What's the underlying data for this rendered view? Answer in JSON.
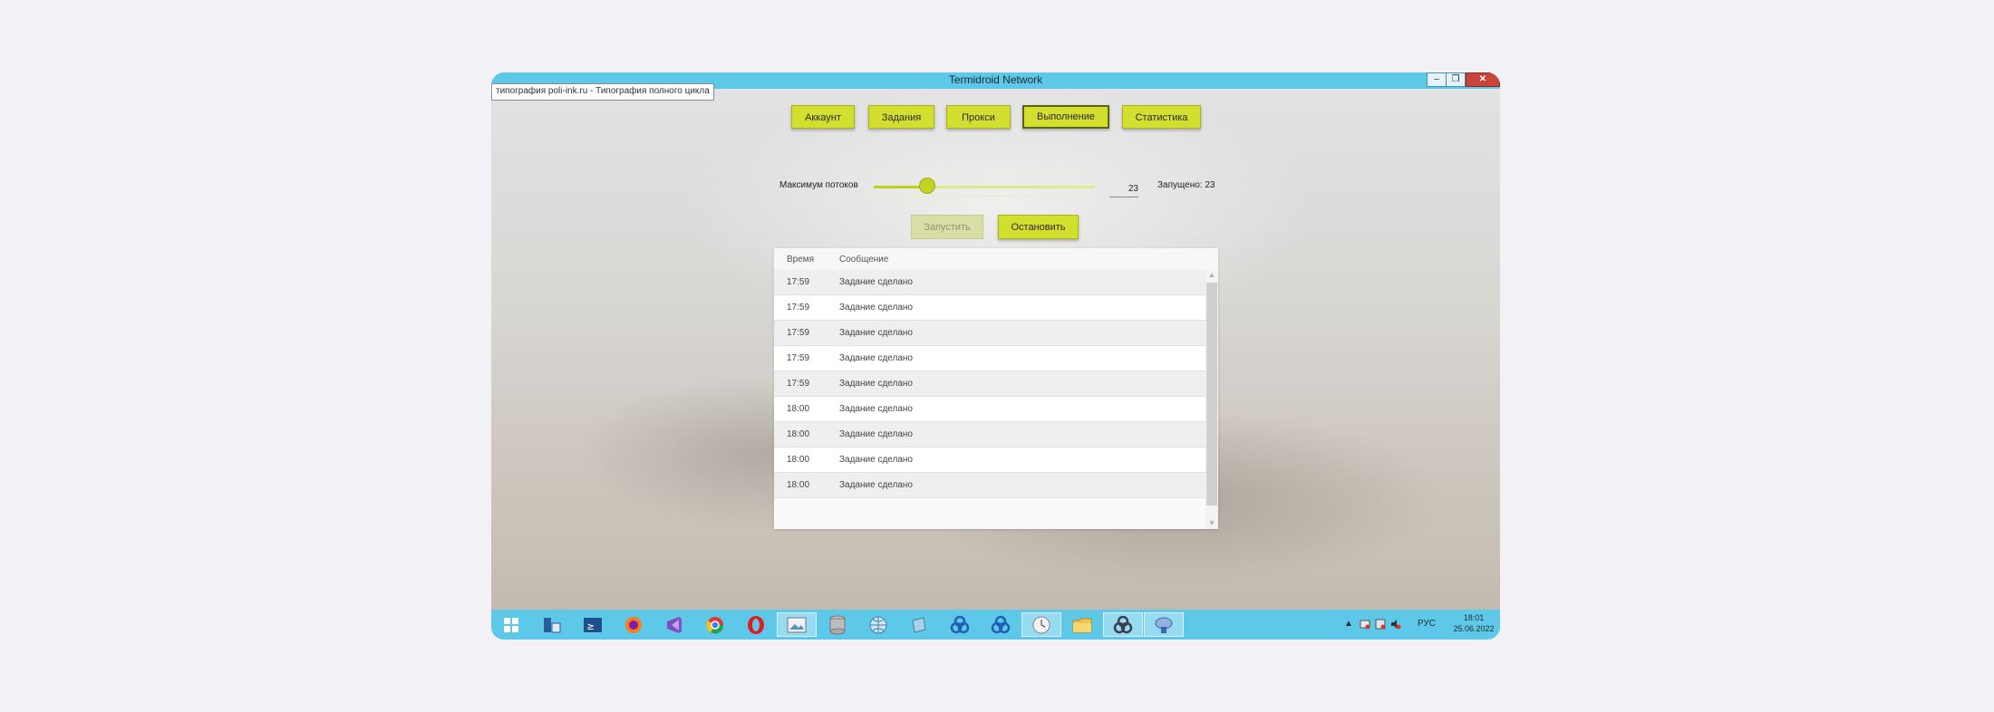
{
  "window": {
    "title": "Termidroid Network"
  },
  "tooltip": "типография poli-ink.ru - Типография полного цикла",
  "nav": {
    "account": "Аккаунт",
    "tasks": "Задания",
    "proxy": "Прокси",
    "execution": "Выполнение",
    "stats": "Статистика"
  },
  "threads": {
    "label": "Максимум потоков",
    "value": "23",
    "running": "Запущено: 23",
    "level_fraction": 0.24
  },
  "actions": {
    "start": "Запустить",
    "stop": "Остановить"
  },
  "log": {
    "col_time": "Время",
    "col_message": "Сообщение",
    "rows": [
      {
        "time": "17:59",
        "message": "Задание сделано"
      },
      {
        "time": "17:59",
        "message": "Задание сделано"
      },
      {
        "time": "17:59",
        "message": "Задание сделано"
      },
      {
        "time": "17:59",
        "message": "Задание сделано"
      },
      {
        "time": "17:59",
        "message": "Задание сделано"
      },
      {
        "time": "18:00",
        "message": "Задание сделано"
      },
      {
        "time": "18:00",
        "message": "Задание сделано"
      },
      {
        "time": "18:00",
        "message": "Задание сделано"
      },
      {
        "time": "18:00",
        "message": "Задание сделано"
      }
    ]
  },
  "taskbar": {
    "lang": "РУС",
    "time": "18:01",
    "date": "25.06.2022",
    "apps": [
      "start-icon",
      "server-manager-icon",
      "powershell-icon",
      "firefox-icon",
      "visual-studio-icon",
      "chrome-icon",
      "opera-icon",
      "photo-viewer-icon",
      "database-icon",
      "globe-icon",
      "notepad-icon",
      "network-app-icon",
      "network-app-icon",
      "clock-app-icon",
      "file-explorer-icon",
      "network-app-icon",
      "termidroid-icon"
    ]
  },
  "colors": {
    "accent": "#d2df2e",
    "titlebar": "#5ec8e8",
    "close": "#c8433a"
  }
}
